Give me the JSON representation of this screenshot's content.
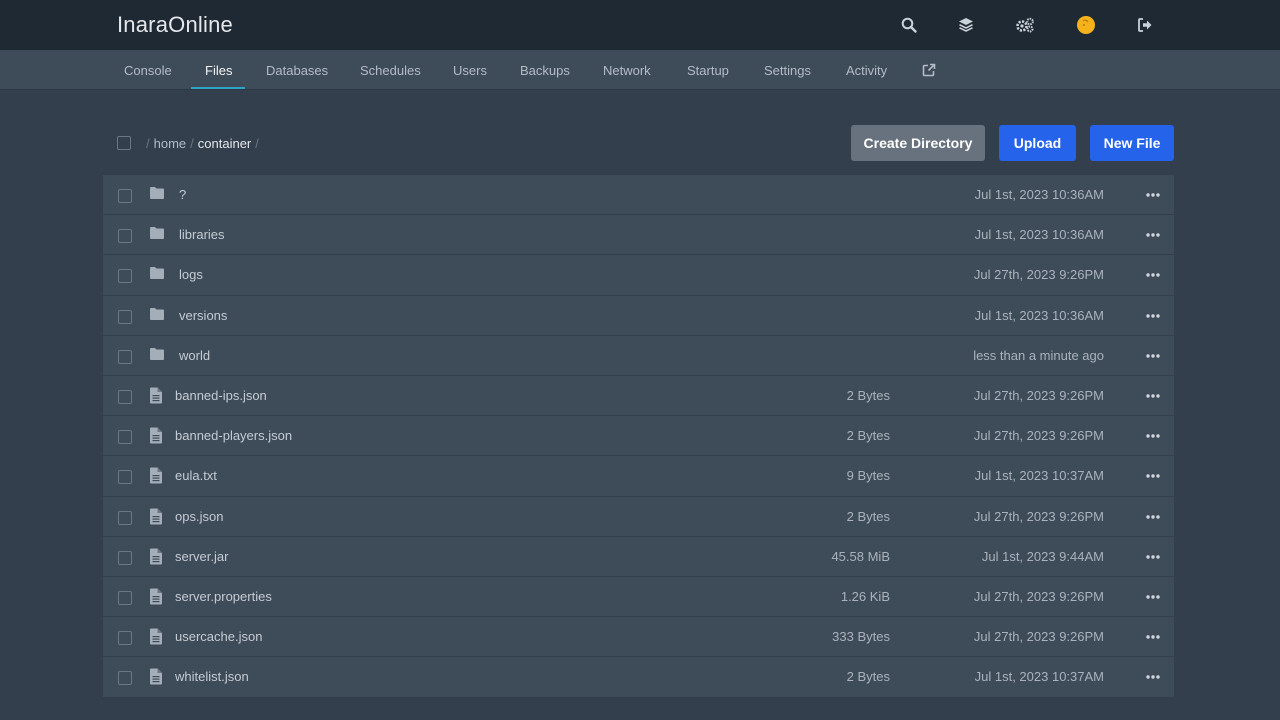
{
  "brand": {
    "title": "InaraOnline"
  },
  "nav": {
    "tabs": [
      {
        "label": "Console",
        "active": false
      },
      {
        "label": "Files",
        "active": true
      },
      {
        "label": "Databases",
        "active": false
      },
      {
        "label": "Schedules",
        "active": false
      },
      {
        "label": "Users",
        "active": false
      },
      {
        "label": "Backups",
        "active": false
      },
      {
        "label": "Network",
        "active": false
      },
      {
        "label": "Startup",
        "active": false
      },
      {
        "label": "Settings",
        "active": false
      },
      {
        "label": "Activity",
        "active": false
      }
    ],
    "external_icon": "external-link-icon"
  },
  "top_icons": [
    "search-icon",
    "layers-icon",
    "cogs-icon",
    "avatar-icon",
    "sign-out-icon"
  ],
  "breadcrumb": {
    "separator": "/",
    "segments": [
      "home",
      "container"
    ]
  },
  "toolbar": {
    "create_directory_label": "Create Directory",
    "upload_label": "Upload",
    "new_file_label": "New File"
  },
  "colors": {
    "accent": "#2ea3c5",
    "primary_button": "#2563eb",
    "secondary_button": "#67727e",
    "avatar": "#f5b21b"
  },
  "files": [
    {
      "name": "?",
      "type": "folder",
      "size": "",
      "modified": "Jul 1st, 2023 10:36AM"
    },
    {
      "name": "libraries",
      "type": "folder",
      "size": "",
      "modified": "Jul 1st, 2023 10:36AM"
    },
    {
      "name": "logs",
      "type": "folder",
      "size": "",
      "modified": "Jul 27th, 2023 9:26PM"
    },
    {
      "name": "versions",
      "type": "folder",
      "size": "",
      "modified": "Jul 1st, 2023 10:36AM"
    },
    {
      "name": "world",
      "type": "folder",
      "size": "",
      "modified": "less than a minute ago"
    },
    {
      "name": "banned-ips.json",
      "type": "file",
      "size": "2 Bytes",
      "modified": "Jul 27th, 2023 9:26PM"
    },
    {
      "name": "banned-players.json",
      "type": "file",
      "size": "2 Bytes",
      "modified": "Jul 27th, 2023 9:26PM"
    },
    {
      "name": "eula.txt",
      "type": "file",
      "size": "9 Bytes",
      "modified": "Jul 1st, 2023 10:37AM"
    },
    {
      "name": "ops.json",
      "type": "file",
      "size": "2 Bytes",
      "modified": "Jul 27th, 2023 9:26PM"
    },
    {
      "name": "server.jar",
      "type": "file",
      "size": "45.58 MiB",
      "modified": "Jul 1st, 2023 9:44AM"
    },
    {
      "name": "server.properties",
      "type": "file",
      "size": "1.26 KiB",
      "modified": "Jul 27th, 2023 9:26PM"
    },
    {
      "name": "usercache.json",
      "type": "file",
      "size": "333 Bytes",
      "modified": "Jul 27th, 2023 9:26PM"
    },
    {
      "name": "whitelist.json",
      "type": "file",
      "size": "2 Bytes",
      "modified": "Jul 1st, 2023 10:37AM"
    }
  ]
}
